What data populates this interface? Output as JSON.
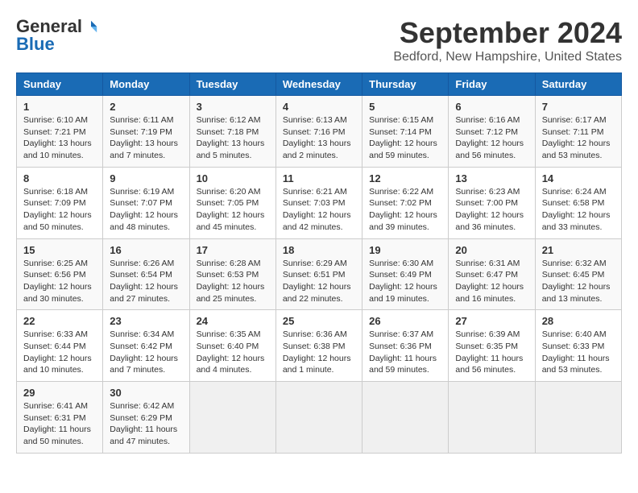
{
  "logo": {
    "general": "General",
    "blue": "Blue"
  },
  "title": "September 2024",
  "location": "Bedford, New Hampshire, United States",
  "days_of_week": [
    "Sunday",
    "Monday",
    "Tuesday",
    "Wednesday",
    "Thursday",
    "Friday",
    "Saturday"
  ],
  "weeks": [
    [
      {
        "day": "1",
        "info": "Sunrise: 6:10 AM\nSunset: 7:21 PM\nDaylight: 13 hours and 10 minutes."
      },
      {
        "day": "2",
        "info": "Sunrise: 6:11 AM\nSunset: 7:19 PM\nDaylight: 13 hours and 7 minutes."
      },
      {
        "day": "3",
        "info": "Sunrise: 6:12 AM\nSunset: 7:18 PM\nDaylight: 13 hours and 5 minutes."
      },
      {
        "day": "4",
        "info": "Sunrise: 6:13 AM\nSunset: 7:16 PM\nDaylight: 13 hours and 2 minutes."
      },
      {
        "day": "5",
        "info": "Sunrise: 6:15 AM\nSunset: 7:14 PM\nDaylight: 12 hours and 59 minutes."
      },
      {
        "day": "6",
        "info": "Sunrise: 6:16 AM\nSunset: 7:12 PM\nDaylight: 12 hours and 56 minutes."
      },
      {
        "day": "7",
        "info": "Sunrise: 6:17 AM\nSunset: 7:11 PM\nDaylight: 12 hours and 53 minutes."
      }
    ],
    [
      {
        "day": "8",
        "info": "Sunrise: 6:18 AM\nSunset: 7:09 PM\nDaylight: 12 hours and 50 minutes."
      },
      {
        "day": "9",
        "info": "Sunrise: 6:19 AM\nSunset: 7:07 PM\nDaylight: 12 hours and 48 minutes."
      },
      {
        "day": "10",
        "info": "Sunrise: 6:20 AM\nSunset: 7:05 PM\nDaylight: 12 hours and 45 minutes."
      },
      {
        "day": "11",
        "info": "Sunrise: 6:21 AM\nSunset: 7:03 PM\nDaylight: 12 hours and 42 minutes."
      },
      {
        "day": "12",
        "info": "Sunrise: 6:22 AM\nSunset: 7:02 PM\nDaylight: 12 hours and 39 minutes."
      },
      {
        "day": "13",
        "info": "Sunrise: 6:23 AM\nSunset: 7:00 PM\nDaylight: 12 hours and 36 minutes."
      },
      {
        "day": "14",
        "info": "Sunrise: 6:24 AM\nSunset: 6:58 PM\nDaylight: 12 hours and 33 minutes."
      }
    ],
    [
      {
        "day": "15",
        "info": "Sunrise: 6:25 AM\nSunset: 6:56 PM\nDaylight: 12 hours and 30 minutes."
      },
      {
        "day": "16",
        "info": "Sunrise: 6:26 AM\nSunset: 6:54 PM\nDaylight: 12 hours and 27 minutes."
      },
      {
        "day": "17",
        "info": "Sunrise: 6:28 AM\nSunset: 6:53 PM\nDaylight: 12 hours and 25 minutes."
      },
      {
        "day": "18",
        "info": "Sunrise: 6:29 AM\nSunset: 6:51 PM\nDaylight: 12 hours and 22 minutes."
      },
      {
        "day": "19",
        "info": "Sunrise: 6:30 AM\nSunset: 6:49 PM\nDaylight: 12 hours and 19 minutes."
      },
      {
        "day": "20",
        "info": "Sunrise: 6:31 AM\nSunset: 6:47 PM\nDaylight: 12 hours and 16 minutes."
      },
      {
        "day": "21",
        "info": "Sunrise: 6:32 AM\nSunset: 6:45 PM\nDaylight: 12 hours and 13 minutes."
      }
    ],
    [
      {
        "day": "22",
        "info": "Sunrise: 6:33 AM\nSunset: 6:44 PM\nDaylight: 12 hours and 10 minutes."
      },
      {
        "day": "23",
        "info": "Sunrise: 6:34 AM\nSunset: 6:42 PM\nDaylight: 12 hours and 7 minutes."
      },
      {
        "day": "24",
        "info": "Sunrise: 6:35 AM\nSunset: 6:40 PM\nDaylight: 12 hours and 4 minutes."
      },
      {
        "day": "25",
        "info": "Sunrise: 6:36 AM\nSunset: 6:38 PM\nDaylight: 12 hours and 1 minute."
      },
      {
        "day": "26",
        "info": "Sunrise: 6:37 AM\nSunset: 6:36 PM\nDaylight: 11 hours and 59 minutes."
      },
      {
        "day": "27",
        "info": "Sunrise: 6:39 AM\nSunset: 6:35 PM\nDaylight: 11 hours and 56 minutes."
      },
      {
        "day": "28",
        "info": "Sunrise: 6:40 AM\nSunset: 6:33 PM\nDaylight: 11 hours and 53 minutes."
      }
    ],
    [
      {
        "day": "29",
        "info": "Sunrise: 6:41 AM\nSunset: 6:31 PM\nDaylight: 11 hours and 50 minutes."
      },
      {
        "day": "30",
        "info": "Sunrise: 6:42 AM\nSunset: 6:29 PM\nDaylight: 11 hours and 47 minutes."
      },
      {
        "day": "",
        "info": ""
      },
      {
        "day": "",
        "info": ""
      },
      {
        "day": "",
        "info": ""
      },
      {
        "day": "",
        "info": ""
      },
      {
        "day": "",
        "info": ""
      }
    ]
  ]
}
